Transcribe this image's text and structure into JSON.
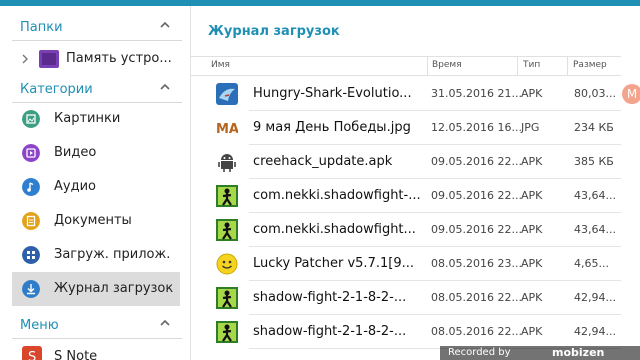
{
  "sidebar": {
    "folders_title": "Папки",
    "device_item": "Память устро...",
    "categories_title": "Категории",
    "categories": [
      {
        "label": "Картинки",
        "icon": "image-icon",
        "color": "#3d9e83"
      },
      {
        "label": "Видео",
        "icon": "video-icon",
        "color": "#8e44c8"
      },
      {
        "label": "Аудио",
        "icon": "audio-icon",
        "color": "#2f7fd0"
      },
      {
        "label": "Документы",
        "icon": "document-icon",
        "color": "#e3a21a"
      },
      {
        "label": "Загруж. прилож.",
        "icon": "apps-icon",
        "color": "#2f5fa8"
      },
      {
        "label": "Журнал загрузок",
        "icon": "download-icon",
        "color": "#2e7dc8",
        "active": true
      }
    ],
    "menu_title": "Меню",
    "menu_items": [
      {
        "label": "S Note",
        "icon": "s-note-icon",
        "color": "#d9462b"
      }
    ]
  },
  "main": {
    "title": "Журнал загрузок",
    "columns": {
      "name": "Имя",
      "time": "Время",
      "type": "Тип",
      "size": "Размер"
    },
    "rows": [
      {
        "name": "Hungry-Shark-Evolutio...",
        "time": "31.05.2016 21...",
        "type": "APK",
        "size": "80,03...",
        "icon": "shark-app-icon"
      },
      {
        "name": "9 мая День Победы.jpg",
        "time": "12.05.2016 16...",
        "type": "JPG",
        "size": "234 КБ",
        "icon": "image-thumbnail-icon"
      },
      {
        "name": "creehack_update.apk",
        "time": "09.05.2016 22...",
        "type": "APK",
        "size": "385 КБ",
        "icon": "android-robot-icon"
      },
      {
        "name": "com.nekki.shadowfight-...",
        "time": "09.05.2016 22...",
        "type": "APK",
        "size": "43,64...",
        "icon": "shadow-fight-icon"
      },
      {
        "name": "com.nekki.shadowfight...",
        "time": "09.05.2016 22...",
        "type": "APK",
        "size": "43,64...",
        "icon": "shadow-fight-icon"
      },
      {
        "name": "Lucky Patcher v5.7.1[9...",
        "time": "08.05.2016 23...",
        "type": "APK",
        "size": "4,65...",
        "icon": "smiley-icon"
      },
      {
        "name": "shadow-fight-2-1-8-2-...",
        "time": "08.05.2016 22...",
        "type": "APK",
        "size": "42,94...",
        "icon": "shadow-fight-icon"
      },
      {
        "name": "shadow-fight-2-1-8-2-...",
        "time": "08.05.2016 22...",
        "type": "APK",
        "size": "42,94...",
        "icon": "shadow-fight-icon"
      }
    ]
  },
  "overlay": {
    "recorded_by": "Recorded by",
    "mobizen": "mobizen"
  }
}
